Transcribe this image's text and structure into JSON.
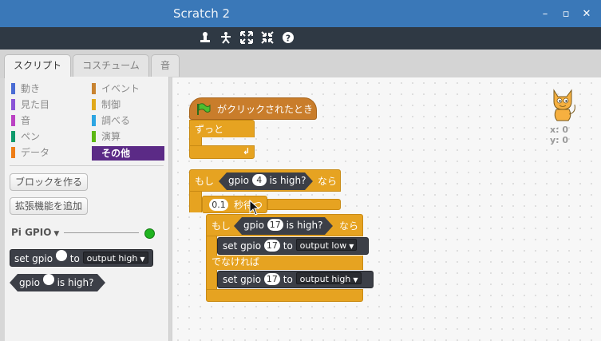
{
  "window": {
    "title": "Scratch 2"
  },
  "toolbar": {
    "tools": [
      "duplicate-stamp-icon",
      "cut-scissors-icon",
      "grow-icon",
      "shrink-icon",
      "help-icon"
    ]
  },
  "tabs": [
    {
      "label": "スクリプト",
      "active": true
    },
    {
      "label": "コスチューム",
      "active": false
    },
    {
      "label": "音",
      "active": false
    }
  ],
  "categories": [
    {
      "label": "動き",
      "color": "#4a6cd4"
    },
    {
      "label": "イベント",
      "color": "#c88330"
    },
    {
      "label": "見た目",
      "color": "#8a55d7"
    },
    {
      "label": "制御",
      "color": "#e1a91a"
    },
    {
      "label": "音",
      "color": "#bb42c3"
    },
    {
      "label": "調べる",
      "color": "#2ca5e2"
    },
    {
      "label": "ペン",
      "color": "#0e9a6c"
    },
    {
      "label": "演算",
      "color": "#5cb712"
    },
    {
      "label": "データ",
      "color": "#ee7d16"
    },
    {
      "label": "その他",
      "color": "#632d99",
      "selected": true
    }
  ],
  "palette_buttons": {
    "make_block": "ブロックを作る",
    "add_extension": "拡張機能を追加"
  },
  "extension": {
    "name": "Pi GPIO",
    "status_color": "#1fb31f",
    "set_block": {
      "set": "set",
      "gpio": "gpio",
      "to": "to",
      "value": "output high"
    },
    "high_block": {
      "gpio": "gpio",
      "is_high": "is high?"
    }
  },
  "script": {
    "hat": "がクリックされたとき",
    "forever": "ずっと",
    "if1": {
      "if": "もし",
      "gpio": "gpio",
      "pin": "4",
      "is_high": "is high?",
      "then": "なら"
    },
    "wait": {
      "seconds": "0.1",
      "label": "秒待つ"
    },
    "if2": {
      "if": "もし",
      "gpio": "gpio",
      "pin": "17",
      "is_high": "is high?",
      "then": "なら"
    },
    "set_low": {
      "set": "set",
      "gpio": "gpio",
      "pin": "17",
      "to": "to",
      "value": "output low"
    },
    "else": "でなければ",
    "set_high": {
      "set": "set",
      "gpio": "gpio",
      "pin": "17",
      "to": "to",
      "value": "output high"
    }
  },
  "sprite": {
    "x_label": "x: 0",
    "y_label": "y: 0"
  }
}
